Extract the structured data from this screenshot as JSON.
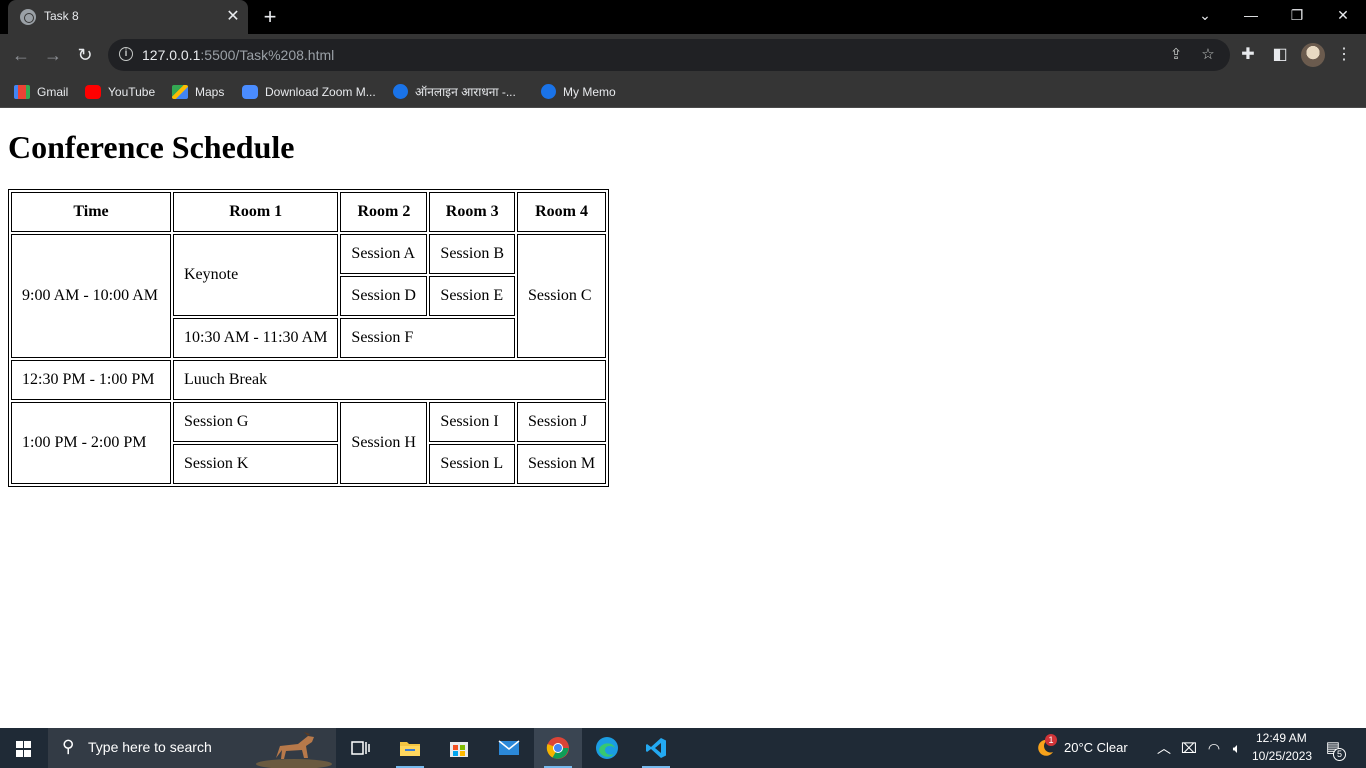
{
  "browser": {
    "tab_title": "Task 8",
    "url_host": "127.0.0.1",
    "url_rest": ":5500/Task%208.html",
    "bookmarks": [
      {
        "label": "Gmail",
        "icon": "gmail-icon"
      },
      {
        "label": "YouTube",
        "icon": "youtube-icon"
      },
      {
        "label": "Maps",
        "icon": "maps-icon"
      },
      {
        "label": "Download Zoom M...",
        "icon": "zoom-icon"
      },
      {
        "label": "ऑनलाइन आराधना -...",
        "icon": "globe-icon"
      },
      {
        "label": "My Memo",
        "icon": "globe-icon"
      }
    ]
  },
  "page": {
    "heading": "Conference Schedule",
    "table": {
      "headers": [
        "Time",
        "Room 1",
        "Room 2",
        "Room 3",
        "Room 4"
      ],
      "cells": {
        "time_morning": "9:00 AM - 10:00 AM",
        "keynote": "Keynote",
        "session_a": "Session A",
        "session_b": "Session B",
        "session_c": "Session C",
        "session_d": "Session D",
        "session_e": "Session E",
        "time_late_morning": "10:30 AM - 11:30 AM",
        "session_f": "Session F",
        "time_lunch": "12:30 PM - 1:00 PM",
        "lunch": "Luuch Break",
        "time_afternoon": "1:00 PM - 2:00 PM",
        "session_g": "Session G",
        "session_h": "Session H",
        "session_i": "Session I",
        "session_j": "Session J",
        "session_k": "Session K",
        "session_l": "Session L",
        "session_m": "Session M"
      }
    }
  },
  "taskbar": {
    "search_placeholder": "Type here to search",
    "weather": "20°C  Clear",
    "weather_badge": "1",
    "time": "12:49 AM",
    "date": "10/25/2023",
    "notification_count": "5"
  }
}
